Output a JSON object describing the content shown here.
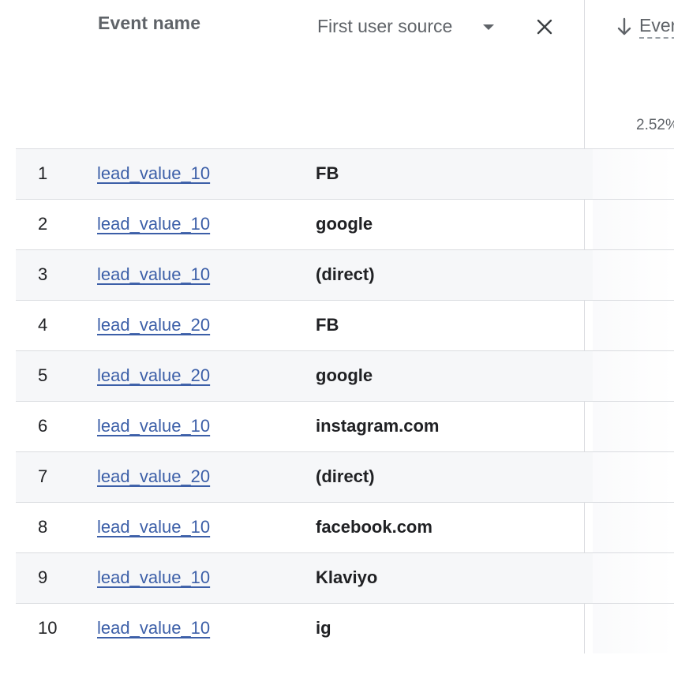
{
  "header": {
    "event_name_label": "Event name",
    "first_user_source_label": "First user source",
    "metric_label": "Ever",
    "metric_total": "2.52%"
  },
  "rows": [
    {
      "index": "1",
      "event": "lead_value_10",
      "source": "FB"
    },
    {
      "index": "2",
      "event": "lead_value_10",
      "source": "google"
    },
    {
      "index": "3",
      "event": "lead_value_10",
      "source": "(direct)"
    },
    {
      "index": "4",
      "event": "lead_value_20",
      "source": "FB"
    },
    {
      "index": "5",
      "event": "lead_value_20",
      "source": "google"
    },
    {
      "index": "6",
      "event": "lead_value_10",
      "source": "instagram.com"
    },
    {
      "index": "7",
      "event": "lead_value_20",
      "source": "(direct)"
    },
    {
      "index": "8",
      "event": "lead_value_10",
      "source": "facebook.com"
    },
    {
      "index": "9",
      "event": "lead_value_10",
      "source": "Klaviyo"
    },
    {
      "index": "10",
      "event": "lead_value_10",
      "source": "ig"
    }
  ],
  "icons": {
    "dropdown": "chevron-down-icon",
    "remove": "close-icon",
    "sort": "arrow-down-icon"
  }
}
